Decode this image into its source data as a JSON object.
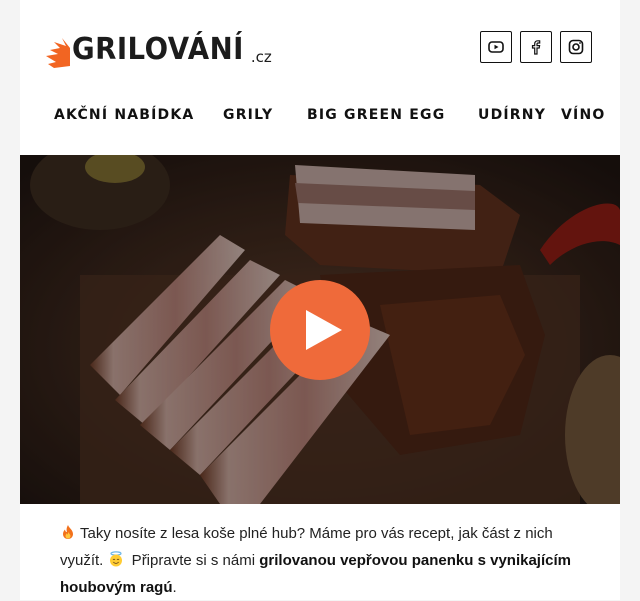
{
  "brand": {
    "logo_main": "GRILOVÁNÍ",
    "logo_tld": ".cz"
  },
  "social": [
    {
      "icon": "youtube-icon"
    },
    {
      "icon": "facebook-icon"
    },
    {
      "icon": "instagram-icon"
    }
  ],
  "nav": {
    "items": [
      {
        "label": "AKČNÍ NABÍDKA"
      },
      {
        "label": "GRILY"
      },
      {
        "label": "BIG GREEN EGG"
      },
      {
        "label": "UDÍRNY"
      },
      {
        "label": "VÍNO"
      }
    ]
  },
  "hero": {
    "play_icon": "play-icon",
    "accent_color": "#ef6a3a"
  },
  "intro": {
    "part1": "Taky nosíte z lesa koše plné hub? Máme pro vás recept, jak část z nich využít.",
    "part2": "Připravte si s námi",
    "bold": "grilovanou vepřovou panenku s vynikajícím houbovým ragú",
    "end": "."
  },
  "colors": {
    "brand_orange": "#f26522",
    "text": "#222222"
  }
}
